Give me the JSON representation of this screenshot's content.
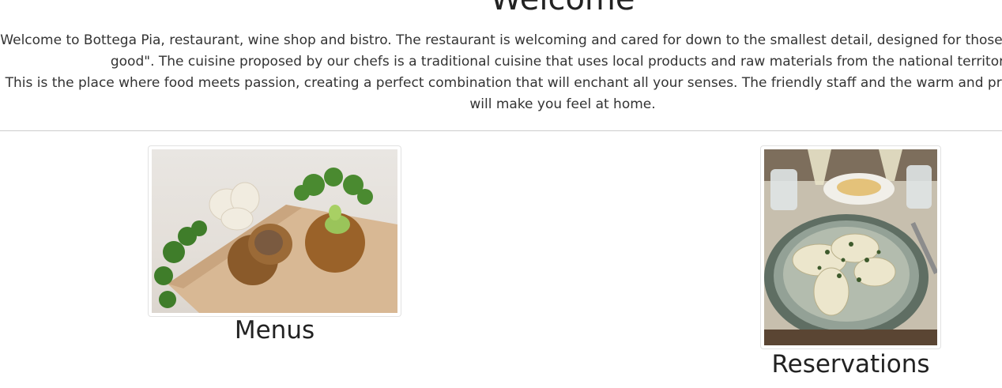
{
  "welcome": {
    "title": "Welcome",
    "paragraph_1": "Welcome to Bottega Pia, restaurant, wine shop and bistro. The restaurant is welcoming and cared for down to the smallest detail, designed for those who want to \"feel good\". The cuisine proposed by our chefs is a traditional cuisine that uses local products and raw materials from the national territory.",
    "paragraph_2": "This is the place where food meets passion, creating a perfect combination that will enchant all your senses. The friendly staff and the warm and private atmosphere will make you feel at home."
  },
  "cards": {
    "menus": {
      "label": "Menus",
      "image_subject": "fried meatballs with garlic and parsley on a wooden board"
    },
    "reservations": {
      "label": "Reservations",
      "image_subject": "plate of ravioli with herbs and glasses of wine on a restaurant table"
    }
  },
  "colors": {
    "text": "#333333",
    "heading": "#222222",
    "divider": "#cccccc",
    "background": "#ffffff"
  }
}
